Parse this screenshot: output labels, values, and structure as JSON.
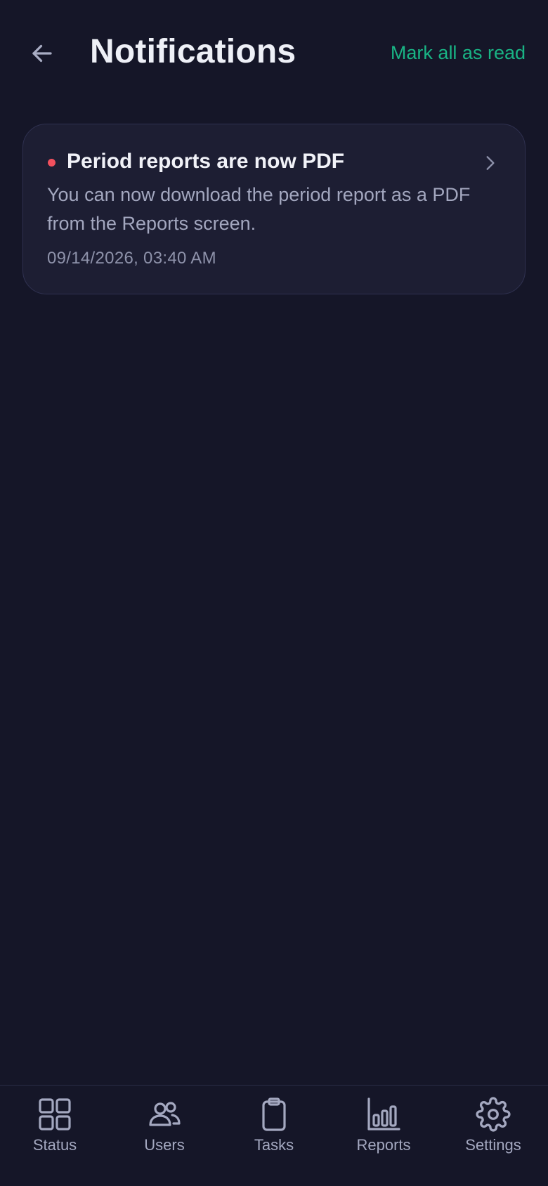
{
  "header": {
    "back_icon": "arrow-left-icon",
    "title": "Notifications",
    "mark_all_label": "Mark all as read"
  },
  "notifications": [
    {
      "title": "Period reports are now PDF",
      "body": "You can now download the period report as a PDF from the Reports screen.",
      "timestamp": "09/14/2026, 03:40 AM",
      "unread": true,
      "icon": "chevron-right-icon"
    }
  ],
  "bottom_nav": {
    "items": [
      {
        "label": "Status",
        "icon": "grid-icon"
      },
      {
        "label": "Users",
        "icon": "users-icon"
      },
      {
        "label": "Tasks",
        "icon": "clipboard-icon"
      },
      {
        "label": "Reports",
        "icon": "bar-chart-icon"
      },
      {
        "label": "Settings",
        "icon": "gear-icon"
      }
    ]
  },
  "colors": {
    "background": "#151628",
    "card": "#1d1e33",
    "accent": "#19b384",
    "unread_dot": "#f2505e",
    "muted_text": "#a3a7bf"
  }
}
